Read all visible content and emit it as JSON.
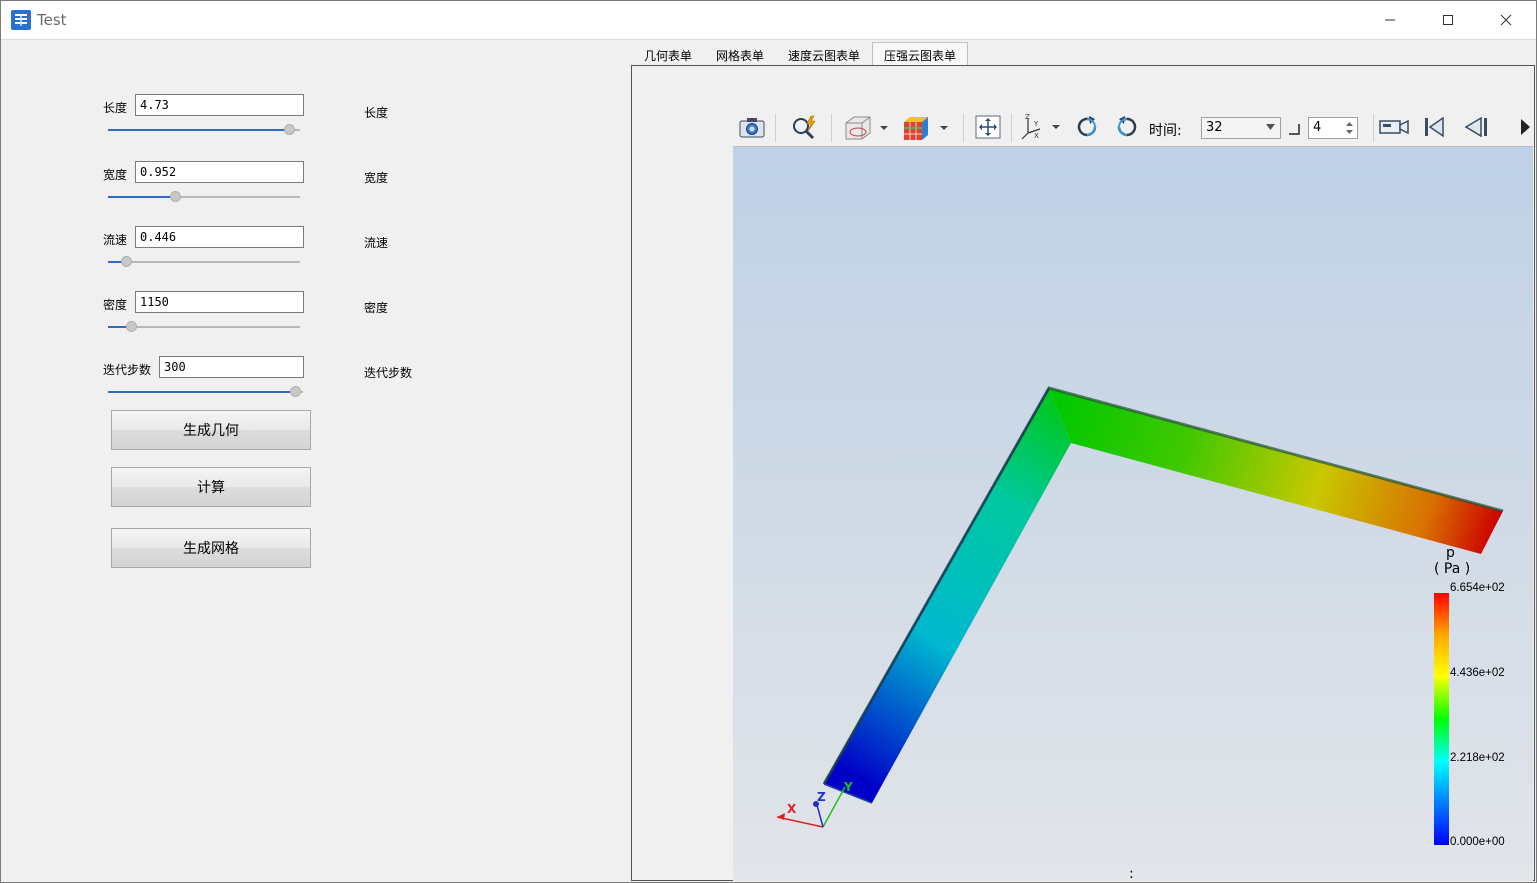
{
  "window": {
    "title": "Test"
  },
  "params": [
    {
      "label": "长度",
      "value": "4.73",
      "right_label": "长度",
      "fraction": 0.97
    },
    {
      "label": "宽度",
      "value": "0.952",
      "right_label": "宽度",
      "fraction": 0.34
    },
    {
      "label": "流速",
      "value": "0.446",
      "right_label": "流速",
      "fraction": 0.07
    },
    {
      "label": "密度",
      "value": "1150",
      "right_label": "密度",
      "fraction": 0.1
    },
    {
      "label": "迭代步数",
      "value": "300",
      "right_label": "迭代步数",
      "fraction": 0.99
    }
  ],
  "buttons": {
    "generate_geometry": "生成几何",
    "compute": "计算",
    "generate_mesh": "生成网格"
  },
  "tabs": [
    "几何表单",
    "网格表单",
    "速度云图表单",
    "压强云图表单"
  ],
  "active_tab": "压强云图表单",
  "viewer": {
    "time_label": "时间:",
    "time_value": "32",
    "step_value": "4",
    "status_mark": ":",
    "axes": {
      "x": "X",
      "y": "Y",
      "z": "Z"
    }
  },
  "legend": {
    "variable": "p",
    "unit": "( Pa )",
    "ticks": [
      "6.654e+02",
      "4.436e+02",
      "2.218e+02",
      "0.000e+00"
    ],
    "colors": [
      "#ff0000",
      "#ffff00",
      "#00ff00",
      "#00ffff",
      "#0000ff"
    ]
  }
}
